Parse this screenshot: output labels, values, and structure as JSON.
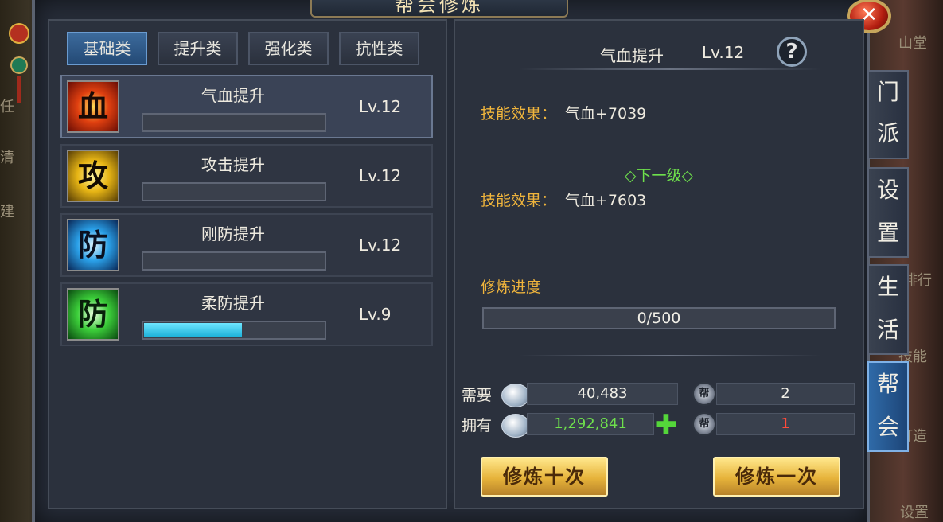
{
  "window": {
    "title": "帮会修炼"
  },
  "tabs": [
    {
      "label": "基础类",
      "active": true
    },
    {
      "label": "提升类",
      "active": false
    },
    {
      "label": "强化类",
      "active": false
    },
    {
      "label": "抗性类",
      "active": false
    }
  ],
  "skills": [
    {
      "name": "气血提升",
      "level": "Lv.12",
      "icon_char": "血",
      "icon": "blood-skill-icon",
      "progress": 0,
      "selected": true
    },
    {
      "name": "攻击提升",
      "level": "Lv.12",
      "icon_char": "攻",
      "icon": "attack-skill-icon",
      "progress": 0,
      "selected": false
    },
    {
      "name": "刚防提升",
      "level": "Lv.12",
      "icon_char": "防",
      "icon": "physical-defense-skill-icon",
      "progress": 0,
      "selected": false
    },
    {
      "name": "柔防提升",
      "level": "Lv.9",
      "icon_char": "防",
      "icon": "magic-defense-skill-icon",
      "progress": 0.54,
      "selected": false
    }
  ],
  "detail": {
    "name": "气血提升",
    "level": "Lv.12",
    "help": "?",
    "effect_label": "技能效果：",
    "current_effect": "气血+7039",
    "next_level_label": "◇下一级◇",
    "next_effect": "气血+7603",
    "progress_label": "修炼进度",
    "progress_text": "0/500"
  },
  "cost": {
    "need_label": "需要",
    "have_label": "拥有",
    "need_silver": "40,483",
    "have_silver": "1,292,841",
    "need_token": "2",
    "have_token": "1",
    "token_char": "帮"
  },
  "buttons": {
    "train_ten": "修炼十次",
    "train_once": "修炼一次",
    "plus": "✚",
    "close": "✕"
  },
  "side_tabs": [
    {
      "label": "门派",
      "active": false
    },
    {
      "label": "设置",
      "active": false
    },
    {
      "label": "生活",
      "active": false
    },
    {
      "label": "帮会",
      "active": true
    }
  ],
  "background_text": [
    "任",
    "清",
    "建",
    "排行",
    "技能",
    "打造",
    "设置",
    "山堂"
  ],
  "colors": {
    "accent_gold": "#f0b53c",
    "green": "#6ee04c",
    "red_value": "#ff4a3a",
    "active_tab": "#3c6a9c"
  }
}
